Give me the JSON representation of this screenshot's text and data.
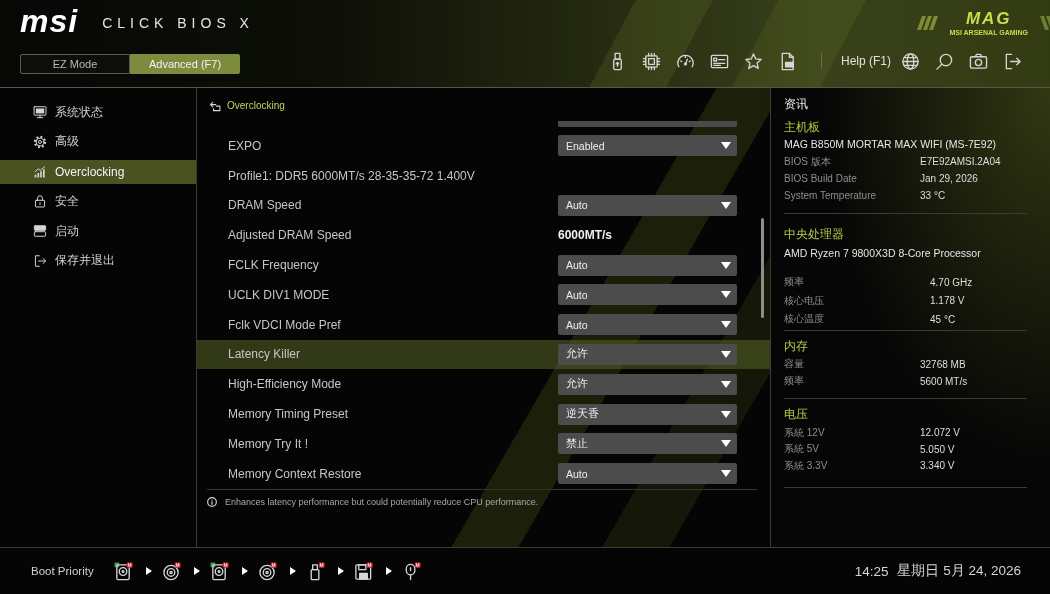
{
  "header": {
    "logo": "msi",
    "product": "CLICK BIOS X",
    "brand": "MAG",
    "brand_tagline": "MSI ARSENAL GAMING"
  },
  "mode_tabs": [
    {
      "label": "EZ Mode",
      "selected": false
    },
    {
      "label": "Advanced (F7)",
      "selected": true
    }
  ],
  "toolbar": {
    "help": "Help (F1)"
  },
  "sidebar": {
    "items": [
      {
        "label": "系统状态",
        "selected": false
      },
      {
        "label": "高级",
        "selected": false
      },
      {
        "label": "Overclocking",
        "selected": true
      },
      {
        "label": "安全",
        "selected": false
      },
      {
        "label": "启动",
        "selected": false
      },
      {
        "label": "保存并退出",
        "selected": false
      }
    ]
  },
  "settings": {
    "breadcrumb": "Overclocking",
    "rows": [
      {
        "label": "EXPO",
        "kind": "dropdown",
        "value": "Enabled",
        "selected": false
      },
      {
        "label": "Profile1: DDR5 6000MT/s 28-35-35-72 1.400V",
        "kind": "info",
        "selected": false
      },
      {
        "label": "DRAM Speed",
        "kind": "dropdown",
        "value": "Auto",
        "selected": false
      },
      {
        "label": "Adjusted DRAM Speed",
        "kind": "readout",
        "value": "6000MT/s",
        "selected": false
      },
      {
        "label": "FCLK Frequency",
        "kind": "dropdown",
        "value": "Auto",
        "selected": false
      },
      {
        "label": "UCLK DIV1 MODE",
        "kind": "dropdown",
        "value": "Auto",
        "selected": false
      },
      {
        "label": "Fclk VDCI Mode Pref",
        "kind": "dropdown",
        "value": "Auto",
        "selected": false
      },
      {
        "label": "Latency Killer",
        "kind": "dropdown",
        "value": "允许",
        "selected": true
      },
      {
        "label": "High-Efficiency Mode",
        "kind": "dropdown",
        "value": "允许",
        "selected": false
      },
      {
        "label": "Memory Timing Preset",
        "kind": "dropdown",
        "value": "逆天香",
        "selected": false
      },
      {
        "label": "Memory Try It !",
        "kind": "dropdown",
        "value": "禁止",
        "selected": false
      },
      {
        "label": "Memory Context Restore",
        "kind": "dropdown",
        "value": "Auto",
        "selected": false
      }
    ],
    "help_text": "Enhances latency performance but could potentially reduce CPU performance."
  },
  "info_panel": {
    "title": "资讯",
    "sections": [
      {
        "heading": "主机板",
        "subtitle": "MAG B850M MORTAR MAX WIFI (MS-7E92)",
        "rows": [
          {
            "label": "BIOS 版本",
            "value": "E7E92AMSI.2A04"
          },
          {
            "label": "BIOS Build Date",
            "value": "Jan 29, 2026"
          },
          {
            "label": "System Temperature",
            "value": "33 °C"
          }
        ]
      },
      {
        "heading": "中央处理器",
        "subtitle": "AMD Ryzen 7 9800X3D 8-Core Processor",
        "rows": [
          {
            "label": "频率",
            "value": "4.70 GHz"
          },
          {
            "label": "核心电压",
            "value": "1.178 V"
          },
          {
            "label": "核心温度",
            "value": "45 °C"
          }
        ]
      },
      {
        "heading": "内存",
        "rows": [
          {
            "label": "容量",
            "value": "32768 MB"
          },
          {
            "label": "频率",
            "value": "5600 MT/s"
          }
        ]
      },
      {
        "heading": "电压",
        "rows": [
          {
            "label": "系統 12V",
            "value": "12.072 V"
          },
          {
            "label": "系統 5V",
            "value": "5.050 V"
          },
          {
            "label": "系統 3.3V",
            "value": "3.340 V"
          }
        ]
      }
    ]
  },
  "boot_priority": {
    "label": "Boot Priority"
  },
  "status_bar": {
    "time": "14:25",
    "date": "星期日 5月 24, 2026"
  }
}
